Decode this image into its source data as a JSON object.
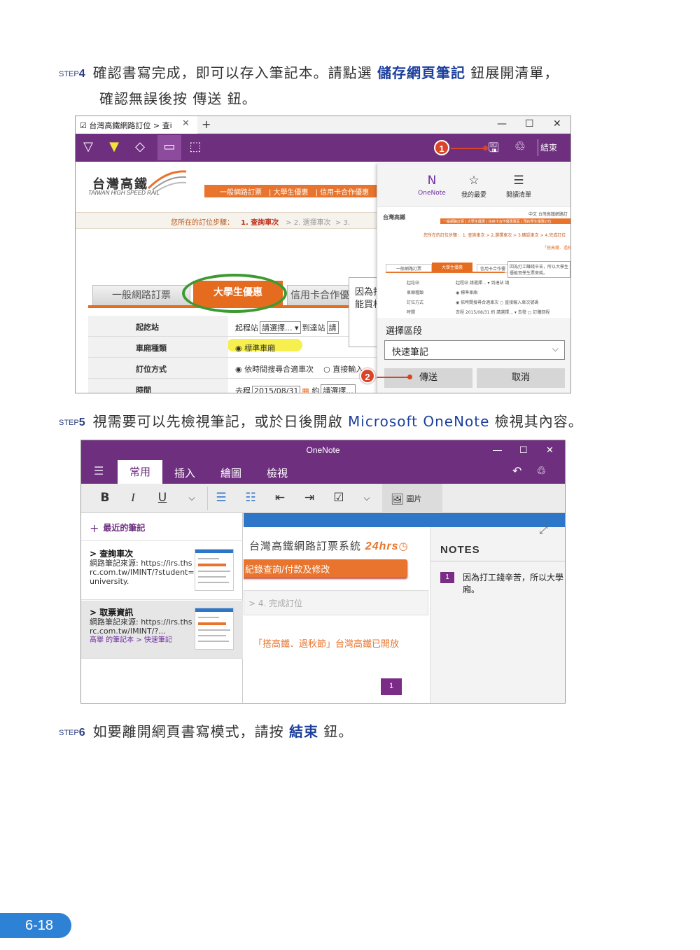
{
  "steps": {
    "s4": {
      "label": "STEP",
      "num": "4",
      "t1": "確認書寫完成，即可以存入筆記本。請點選 ",
      "h1": "儲存網頁筆記",
      "t2": " 鈕展開清單，",
      "t3": "確認無誤後按 ",
      "h2": "傳送",
      "t4": " 鈕。"
    },
    "s5": {
      "label": "STEP",
      "num": "5",
      "t1": "視需要可以先檢視筆記，或於日後開啟 ",
      "h1": "Microsoft OneNote",
      "t2": " 檢視其內容。"
    },
    "s6": {
      "label": "STEP",
      "num": "6",
      "t1": "如要離開網頁書寫模式，請按 ",
      "h1": "結束",
      "t2": " 鈕。"
    }
  },
  "shot1": {
    "tab_title": "台灣高鐵網路訂位 > 查i",
    "tab_close": "✕",
    "new_tab": "+",
    "win_min": "—",
    "win_max": "☐",
    "win_close": "✕",
    "end_label": "結束",
    "marker1": "1",
    "marker2": "2",
    "logo_cn": "台灣高鐵",
    "logo_en": "TAIWAN HIGH SPEED RAIL",
    "nav": [
      "一般網路訂票",
      "大學生優惠",
      "信用卡合作優惠"
    ],
    "crumb_prefix": "您所在的訂位步驟：",
    "crumb_step1": "1. 查詢車次",
    "crumb_step2": "> 2. 選擇車次",
    "crumb_step3": "> 3.",
    "tab_general": "一般網路訂票",
    "tab_student": "大學生優惠",
    "tab_card": "信用卡合作優惠",
    "tooltip": "因為打工賺錢辛苦，所以大學生能買",
    "tooltip_short": "因為打\n能買村",
    "form": [
      {
        "label": "起訖站",
        "value": "起程站",
        "sel": "請選擇...",
        "value2": "到達站",
        "sel2": "請"
      },
      {
        "label": "車廂種類",
        "value": "◉ 標準車廂"
      },
      {
        "label": "訂位方式",
        "value": "◉  依時間搜尋合適車次",
        "value2": "○  直接輸入"
      },
      {
        "label": "時間",
        "value": "去程",
        "sel": "2015/08/31",
        "value2": "約",
        "sel2": "請選擇..."
      }
    ],
    "panel": {
      "icons": [
        {
          "label": "OneNote",
          "icon": "onenote-icon"
        },
        {
          "label": "我的最愛",
          "icon": "star-icon"
        },
        {
          "label": "閱讀清單",
          "icon": "list-icon"
        }
      ],
      "section_label": "選擇區段",
      "section_value": "快速筆記",
      "send": "傳送",
      "cancel": "取消",
      "thumb_top": "中文  台灣高鐵網路訂",
      "thumb_nav": "一般網路訂票 | 大學生優惠 | 信用卡合作優惠專區 | 預約學生優惠訂位",
      "thumb_crumb": "您所在的訂位步驟：  1. 查詢車次  > 2.選擇車次  > 3.確認車次  > 4.完成訂位",
      "thumb_notice": "「搭高鐵．過秋節",
      "thumb_tabs": [
        "一般網路訂票",
        "大學生優惠",
        "信用卡合作優"
      ],
      "thumb_tip": "因為打工賺錢辛苦，所以大學生優能買學生票來耗。",
      "thumb_rows": [
        "起訖站",
        "車廂種類",
        "訂位方式",
        "時間"
      ],
      "thumb_vals": [
        "起程站 請選擇... ▾ 到達站 請",
        "◉ 標準車廂",
        "◉ 依時間搜尋合適車次   ○ 直接輸入車次號碼",
        "去程 2015/08/31  約 請選擇... ▾ 去發 □ 訂購回程"
      ]
    }
  },
  "shot2": {
    "app_title": "OneNote",
    "win_min": "—",
    "win_max": "☐",
    "win_close": "✕",
    "menu": [
      "常用",
      "插入",
      "繪圖",
      "檢視"
    ],
    "picture_label": "圖片",
    "recent": "最近的筆記",
    "notes": [
      {
        "title": "> 查詢車次",
        "desc": "網路筆記來源: https://irs.thsrc.com.tw/IMINT/?student=university.",
        "path": ""
      },
      {
        "title": "> 取票資訊",
        "desc": "網路筆記來源: https://irs.thsrc.com.tw/IMINT/?...",
        "path": "高舉 的筆記本 > 快速筆記"
      }
    ],
    "page_title": "台灣高鐵網路訂票系統",
    "page_title_badge": "24hrs",
    "page_orange": "紀錄查詢/付款及修改",
    "page_step": ">    4. 完成訂位",
    "page_notice": "「搭高鐵．過秋節」台灣高鐵已開放",
    "page_marker": "1",
    "notes_header": "NOTES",
    "note1_num": "1",
    "note1_text": "因為打工錢辛苦，所以大學",
    "note1_text2": "廂。"
  },
  "page_number": "6-18",
  "colors": {
    "accent_purple": "#6e2f7f",
    "accent_orange": "#e8742d",
    "step_blue": "#1c3f9c",
    "marker_red": "#d7452a",
    "page_badge": "#2e82d6"
  }
}
